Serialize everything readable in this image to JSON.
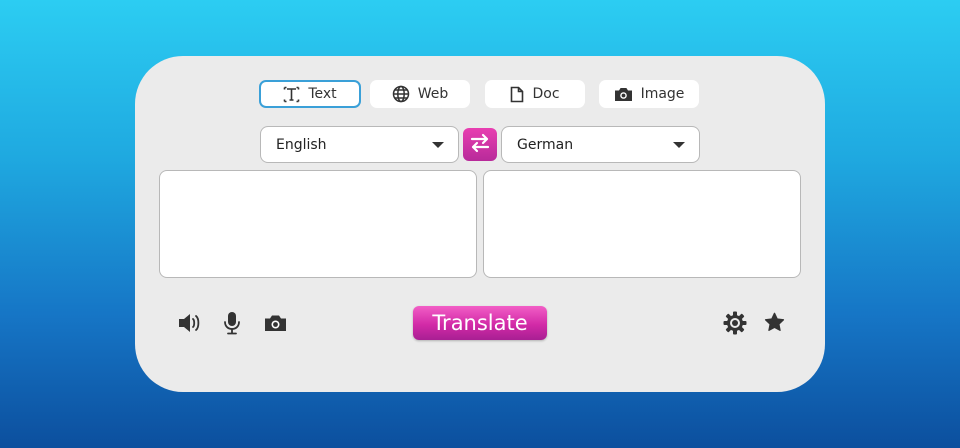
{
  "tabs": [
    {
      "label": "Text",
      "icon": "text-cursor-icon",
      "active": true
    },
    {
      "label": "Web",
      "icon": "globe-icon",
      "active": false
    },
    {
      "label": "Doc",
      "icon": "document-icon",
      "active": false
    },
    {
      "label": "Image",
      "icon": "camera-icon",
      "active": false
    }
  ],
  "source_language": "English",
  "target_language": "German",
  "source_text": "",
  "target_text": "",
  "translate_label": "Translate",
  "toolbar_left": [
    "speaker-icon",
    "microphone-icon",
    "camera-icon"
  ],
  "toolbar_right": [
    "gear-icon",
    "star-icon"
  ],
  "colors": {
    "accent": "#d22aa7",
    "active_tab_border": "#3aa0d8",
    "card": "#ebebeb"
  }
}
